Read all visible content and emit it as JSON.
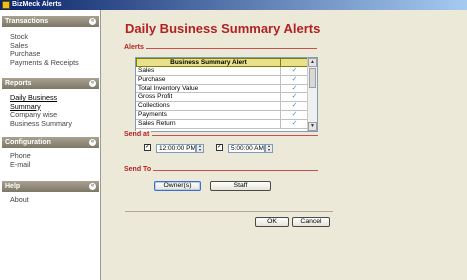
{
  "window": {
    "title": "BizMeck Alerts"
  },
  "sidebar": {
    "sections": [
      {
        "title": "Transactions",
        "items": [
          "Stock",
          "Sales",
          "Purchase",
          "Payments & Receipts"
        ]
      },
      {
        "title": "Reports",
        "items": [
          "Daily Business Summary",
          "Company wise Business Summary"
        ]
      },
      {
        "title": "Configuration",
        "items": [
          "Phone",
          "E-mail"
        ]
      },
      {
        "title": "Help",
        "items": [
          "About"
        ]
      }
    ],
    "reports_items_display": [
      "Daily Business ",
      "Summary",
      "Company wise",
      "Business Summary"
    ]
  },
  "main": {
    "title": "Daily Business Summary Alerts",
    "alerts": {
      "group_label": "Alerts",
      "column_header": "Business Summary Alert",
      "rows": [
        {
          "name": "Sales",
          "checked": true
        },
        {
          "name": "Purchase",
          "checked": true
        },
        {
          "name": "Total Inventory Value",
          "checked": true
        },
        {
          "name": "Gross Profit",
          "checked": true
        },
        {
          "name": "Collections",
          "checked": true
        },
        {
          "name": "Payments",
          "checked": true
        },
        {
          "name": "Sales Return",
          "checked": true
        }
      ]
    },
    "send_at": {
      "group_label": "Send at",
      "time1": {
        "checked": true,
        "value": "12:00:00 PM"
      },
      "time2": {
        "checked": true,
        "value": "5:00:00 AM"
      }
    },
    "send_to": {
      "group_label": "Send To",
      "owner_label": "Owner(s)",
      "staff_label": "Staff"
    },
    "footer": {
      "ok_label": "OK",
      "cancel_label": "Cancel"
    }
  },
  "colors": {
    "accent": "#b22222",
    "header_gradient": "#8f897a",
    "check": "#3a8ec9"
  }
}
